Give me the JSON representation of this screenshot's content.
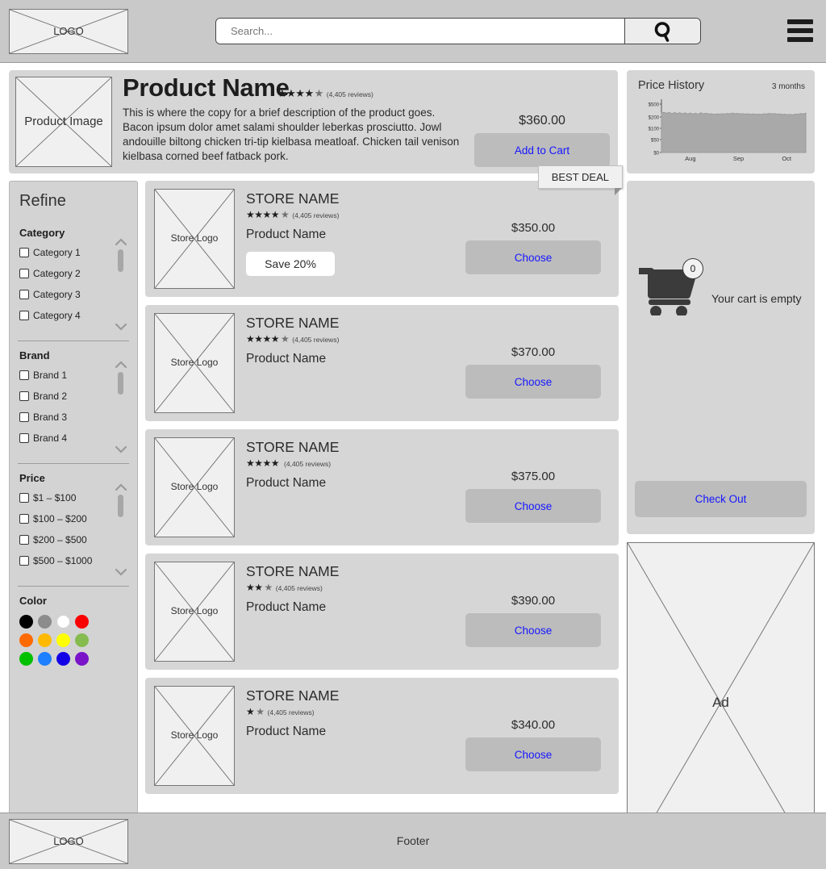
{
  "header": {
    "logo_text": "LOGO",
    "search_placeholder": "Search...",
    "search_value": "",
    "search_icon": "magnifier-icon",
    "menu_icon": "hamburger-menu-icon"
  },
  "hero": {
    "image_label": "Product Image",
    "title": "Product Name",
    "stars": "★★★★",
    "half_star": "★",
    "reviews": "(4,405 reviews)",
    "rating_value": 4.5,
    "description": "This is where the copy for a brief description of the product goes. Bacon ipsum dolor amet salami shoulder leberkas prosciutto. Jowl andouille biltong chicken tri-tip kielbasa meatloaf. Chicken tail venison kielbasa corned beef fatback pork.",
    "price": "$360.00",
    "cart_button": "Add to Cart"
  },
  "price_history": {
    "title": "Price History",
    "range_label": "3 months",
    "y_ticks": [
      "$500",
      "$200",
      "$100",
      "$50",
      "$0"
    ],
    "x_ticks": [
      "Aug",
      "Sep",
      "Oct"
    ]
  },
  "chart_data": {
    "type": "area",
    "title": "Price History",
    "xlabel": "",
    "ylabel": "",
    "x": [
      "Aug",
      "Sep",
      "Oct"
    ],
    "y_tick_labels": [
      "$0",
      "$50",
      "$100",
      "$200",
      "$500"
    ],
    "ylim": [
      0,
      500
    ],
    "grid": false,
    "legend": "none",
    "series": [
      {
        "name": "Price",
        "values": [
          300,
          305,
          288,
          310,
          272,
          305,
          278,
          300,
          272,
          298,
          268,
          292,
          265,
          288,
          262,
          300,
          272,
          288,
          268,
          276,
          262,
          270,
          266,
          274,
          268,
          282,
          272,
          290,
          276,
          284,
          270,
          278,
          266,
          274,
          262,
          272,
          258,
          268,
          256,
          276,
          268,
          284,
          272,
          280,
          266,
          272,
          258,
          266,
          252,
          262,
          248,
          268,
          262,
          280,
          272,
          288
        ]
      }
    ]
  },
  "sidebar": {
    "title": "Refine",
    "facets": [
      {
        "name": "category",
        "label": "Category",
        "options": [
          "Category 1",
          "Category 2",
          "Category 3",
          "Category 4"
        ]
      },
      {
        "name": "brand",
        "label": "Brand",
        "options": [
          "Brand 1",
          "Brand 2",
          "Brand 3",
          "Brand 4"
        ]
      },
      {
        "name": "price",
        "label": "Price",
        "options": [
          "$1 – $100",
          "$100 – $200",
          "$200 – $500",
          "$500 – $1000"
        ]
      }
    ],
    "color": {
      "label": "Color",
      "swatches": [
        "#000000",
        "#8c8c8c",
        "#ffffff",
        "#fb0000",
        "#ff6a00",
        "#ffb900",
        "#ffff00",
        "#86bb50",
        "#00c000",
        "#1e7fff",
        "#1400e6",
        "#7b14c8"
      ]
    }
  },
  "listings": [
    {
      "logo_label": "Store Logo",
      "store_name": "STORE NAME",
      "stars": "★★★★",
      "half_star": "★",
      "rating_value": 4.5,
      "reviews": "(4,405 reviews)",
      "product_name": "Product Name",
      "badge": "Save 20%",
      "ribbon": "BEST DEAL",
      "price": "$350.00",
      "choose": "Choose"
    },
    {
      "logo_label": "Store Logo",
      "store_name": "STORE NAME",
      "stars": "★★★★",
      "half_star": "★",
      "rating_value": 4.5,
      "reviews": "(4,405 reviews)",
      "product_name": "Product Name",
      "badge": "",
      "ribbon": "",
      "price": "$370.00",
      "choose": "Choose"
    },
    {
      "logo_label": "Store Logo",
      "store_name": "STORE NAME",
      "stars": "★★★★",
      "half_star": "",
      "rating_value": 4,
      "reviews": "(4,405 reviews)",
      "product_name": "Product Name",
      "badge": "",
      "ribbon": "",
      "price": "$375.00",
      "choose": "Choose"
    },
    {
      "logo_label": "Store Logo",
      "store_name": "STORE NAME",
      "stars": "★★",
      "half_star": "★",
      "rating_value": 2.5,
      "reviews": "(4,405 reviews)",
      "product_name": "Product Name",
      "badge": "",
      "ribbon": "",
      "price": "$390.00",
      "choose": "Choose"
    },
    {
      "logo_label": "Store Logo",
      "store_name": "STORE NAME",
      "stars": "★",
      "half_star": "★",
      "rating_value": 1.5,
      "reviews": "(4,405 reviews)",
      "product_name": "Product Name",
      "badge": "",
      "ribbon": "",
      "price": "$340.00",
      "choose": "Choose"
    }
  ],
  "cart": {
    "icon": "shopping-cart-icon",
    "count": "0",
    "empty_text": "Your cart is empty",
    "checkout": "Check Out"
  },
  "ad": {
    "label": "Ad"
  },
  "footer": {
    "logo_text": "LOGO",
    "text": "Footer"
  },
  "colors": {
    "accent_link": "#1616ff",
    "page_bg": "#c9c9c9",
    "panel": "#d6d6d6",
    "button": "#bcbcbc"
  }
}
